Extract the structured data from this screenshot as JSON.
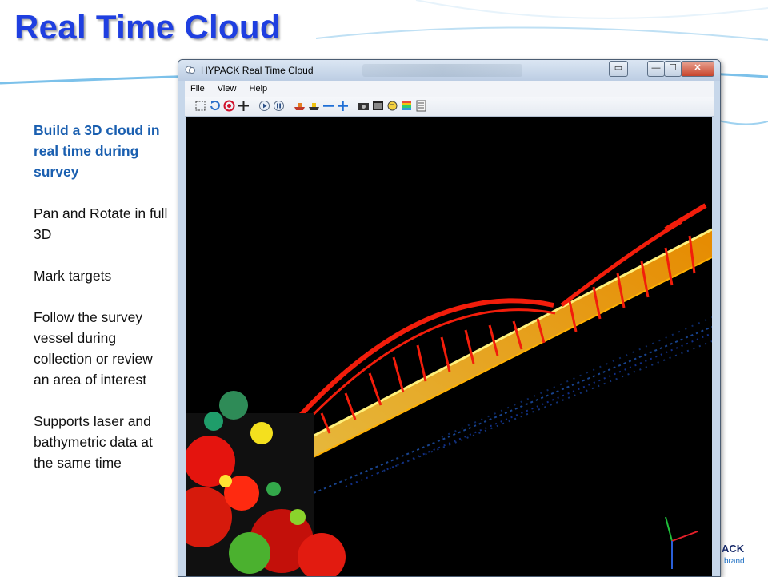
{
  "slide": {
    "title": "Real Time Cloud"
  },
  "sidebar": {
    "items": [
      "Build a 3D cloud in real time during survey",
      "Pan and Rotate in full 3D",
      "Mark targets",
      "Follow the survey vessel during collection or review an area of interest",
      "Supports laser and bathymetric data at the same time"
    ]
  },
  "window": {
    "title": "HYPACK Real Time Cloud",
    "menu": [
      "File",
      "View",
      "Help"
    ],
    "toolbar_icons": [
      "select-region-icon",
      "refresh-icon",
      "target-icon",
      "crosshair-icon",
      "play-icon",
      "pause-icon",
      "vessel-icon",
      "vessel-follow-icon",
      "zoom-out-icon",
      "zoom-in-icon",
      "camera-icon",
      "film-icon",
      "marker-icon",
      "color-scale-icon",
      "list-icon"
    ],
    "buttons": {
      "restore_label": "▭",
      "minimize_label": "—",
      "maximize_label": "☐",
      "close_label": "✕"
    }
  },
  "footer": {
    "logo_fragment": "ACK",
    "brand_fragment": "brand"
  },
  "colors": {
    "title": "#1f3fe0",
    "lead_text": "#1a5fb0",
    "viewport_bg": "#000000"
  }
}
